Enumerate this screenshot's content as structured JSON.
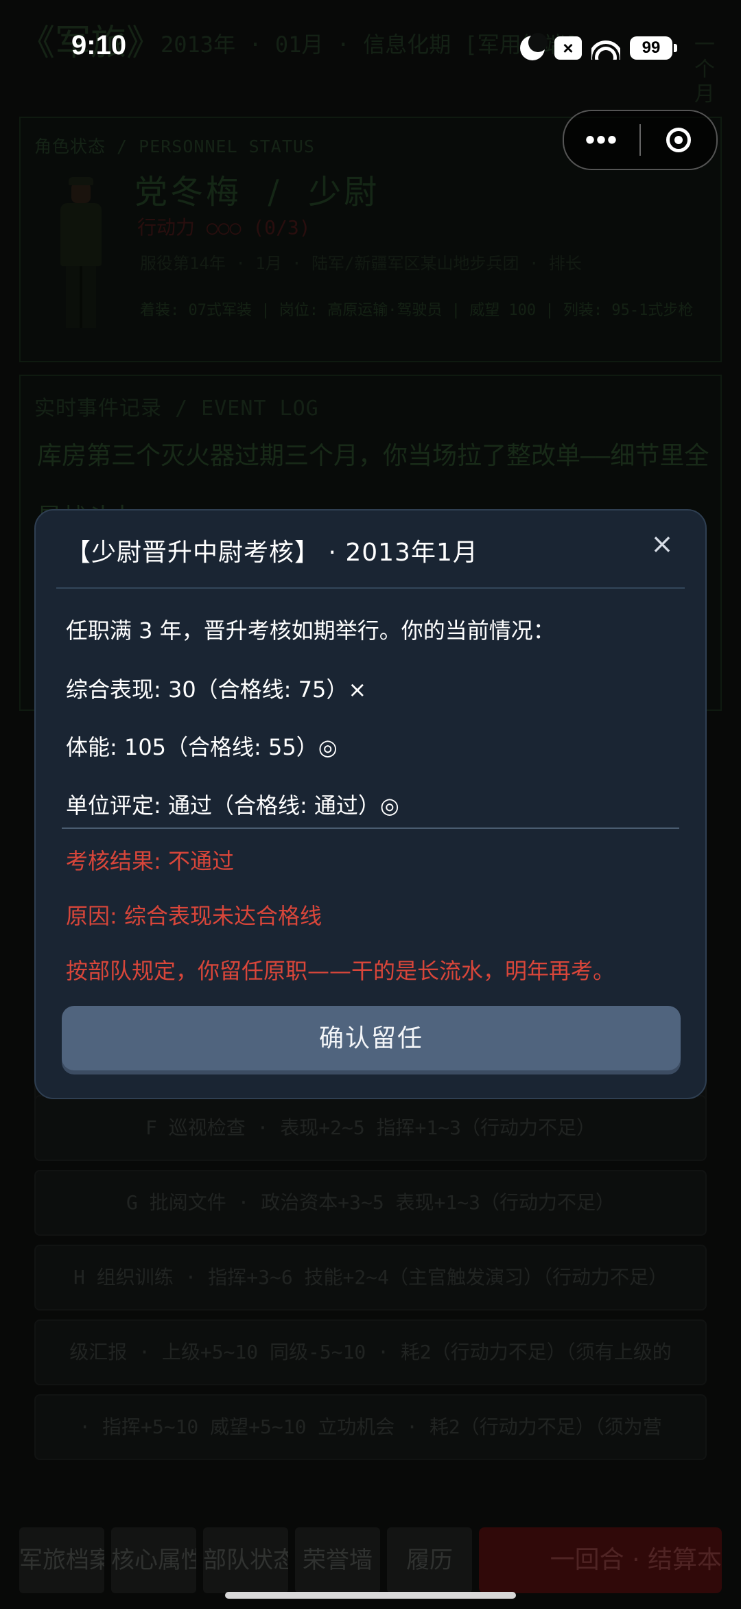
{
  "status_bar": {
    "time": "9:10",
    "battery": "99"
  },
  "header": {
    "game_title": "《军旅》",
    "date_line": "2013年 · 01月 · 信息化期 [军用终端]",
    "tail": "一个月"
  },
  "status_panel": {
    "label": "角色状态 / PERSONNEL STATUS",
    "name_rank": "党冬梅  /  少尉",
    "action_points": "行动力 ○○○ (0/3)",
    "service": "服役第14年 · 1月 · 陆军/新疆军区某山地步兵团 · 排长",
    "gear": "着装: 07式军装 | 岗位: 高原运输·驾驶员 | 威望 100 | 列装: 95-1式步枪"
  },
  "event_panel": {
    "label": "实时事件记录 / EVENT LOG",
    "text": "库房第三个灭火器过期三个月，你当场拉了整改单——细节里全是战斗力。"
  },
  "actions": [
    "F  巡视检查 · 表现+2~5 指挥+1~3（行动力不足）",
    "G  批阅文件 · 政治资本+3~5 表现+1~3（行动力不足）",
    "H  组织训练 · 指挥+3~6 技能+2~4（主官触发演习）（行动力不足）",
    "级汇报 · 上级+5~10 同级-5~10 · 耗2（行动力不足）（须有上级的",
    "· 指挥+5~10 威望+5~10 立功机会 · 耗2（行动力不足）（须为营"
  ],
  "tabs": [
    "军旅档案",
    "核心属性",
    "部队状态",
    "荣誉墙",
    "履历"
  ],
  "end_turn": "一回合 · 结算本",
  "modal": {
    "title": "【少尉晋升中尉考核】 · 2013年1月",
    "close": "×",
    "intro": "任职满 3 年，晋升考核如期举行。你的当前情况：",
    "row1": "综合表现: 30（合格线: 75）×",
    "row2": "体能: 105（合格线: 55）◎",
    "row3": "单位评定: 通过（合格线: 通过）◎",
    "result": "考核结果: 不通过",
    "reason": "原因: 综合表现未达合格线",
    "note": "按部队规定，你留任原职——干的是长流水，明年再考。",
    "confirm": "确认留任"
  }
}
